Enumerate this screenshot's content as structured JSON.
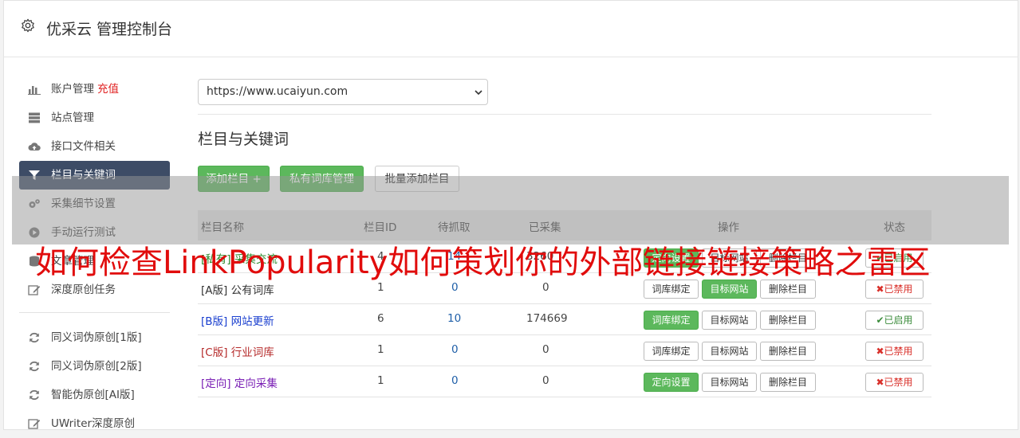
{
  "header": {
    "title": "优采云 管理控制台"
  },
  "sidebar": {
    "items": [
      {
        "label": "账户管理",
        "extra": "充值",
        "icon": "bar-chart-icon"
      },
      {
        "label": "站点管理",
        "icon": "server-icon"
      },
      {
        "label": "接口文件相关",
        "icon": "cloud-upload-icon"
      },
      {
        "label": "栏目与关键词",
        "icon": "filter-icon",
        "active": true
      },
      {
        "label": "采集细节设置",
        "icon": "cogs-icon"
      },
      {
        "label": "手动运行测试",
        "icon": "play-circle-icon"
      },
      {
        "label": "文章管理",
        "icon": "database-icon"
      },
      {
        "label": "深度原创任务",
        "icon": "edit-icon"
      }
    ],
    "items2": [
      {
        "label": "同义词伪原创[1版]",
        "icon": "refresh-icon"
      },
      {
        "label": "同义词伪原创[2版]",
        "icon": "refresh-icon"
      },
      {
        "label": "智能伪原创[AI版]",
        "icon": "refresh-icon"
      },
      {
        "label": "UWriter深度原创",
        "icon": "edit-icon"
      }
    ]
  },
  "site_select": {
    "value": "https://www.ucaiyun.com"
  },
  "section": {
    "title": "栏目与关键词"
  },
  "toolbar": {
    "add_column": "添加栏目 +",
    "private_lib": "私有词库管理",
    "batch_add": "批量添加栏目"
  },
  "table": {
    "headers": {
      "name": "栏目名称",
      "id": "栏目ID",
      "pending": "待抓取",
      "collected": "已采集",
      "ops": "操作",
      "status": "状态"
    },
    "rows": [
      {
        "tag": "[私有]",
        "name": "采集交流",
        "id": "4",
        "pending": "14",
        "collected": "3260",
        "op1": "定向设置",
        "op1_green": true,
        "op2": "目标网站",
        "op3": "删除栏目",
        "status": "已启用",
        "on": true,
        "color": "#2e8b2e"
      },
      {
        "tag": "[A版]",
        "name": "公有词库",
        "id": "1",
        "pending": "0",
        "collected": "0",
        "op1": "词库绑定",
        "op1_green": false,
        "op2": "目标网站",
        "op2_green": true,
        "op3": "删除栏目",
        "status": "已禁用",
        "on": false,
        "color": "#333333"
      },
      {
        "tag": "[B版]",
        "name": "网站更新",
        "id": "6",
        "pending": "10",
        "collected": "174669",
        "op1": "词库绑定",
        "op1_green": true,
        "op2": "目标网站",
        "op3": "删除栏目",
        "status": "已启用",
        "on": true,
        "color": "#1a3fcf"
      },
      {
        "tag": "[C版]",
        "name": "行业词库",
        "id": "1",
        "pending": "0",
        "collected": "0",
        "op1": "词库绑定",
        "op1_green": false,
        "op2": "目标网站",
        "op3": "删除栏目",
        "status": "已禁用",
        "on": false,
        "color": "#b52a2a"
      },
      {
        "tag": "[定向]",
        "name": "定向采集",
        "id": "1",
        "pending": "0",
        "collected": "0",
        "op1": "定向设置",
        "op1_green": true,
        "op2": "目标网站",
        "op3": "删除栏目",
        "status": "已禁用",
        "on": false,
        "color": "#7a1fb5"
      }
    ]
  },
  "banner": {
    "text": "如何检查LinkPopularity如何策划你的外部链接链接策略之雷区"
  },
  "colors": {
    "accent_green": "#5cb85c",
    "sidebar_active": "#3d4c66",
    "banner_red": "#e10c0c"
  }
}
